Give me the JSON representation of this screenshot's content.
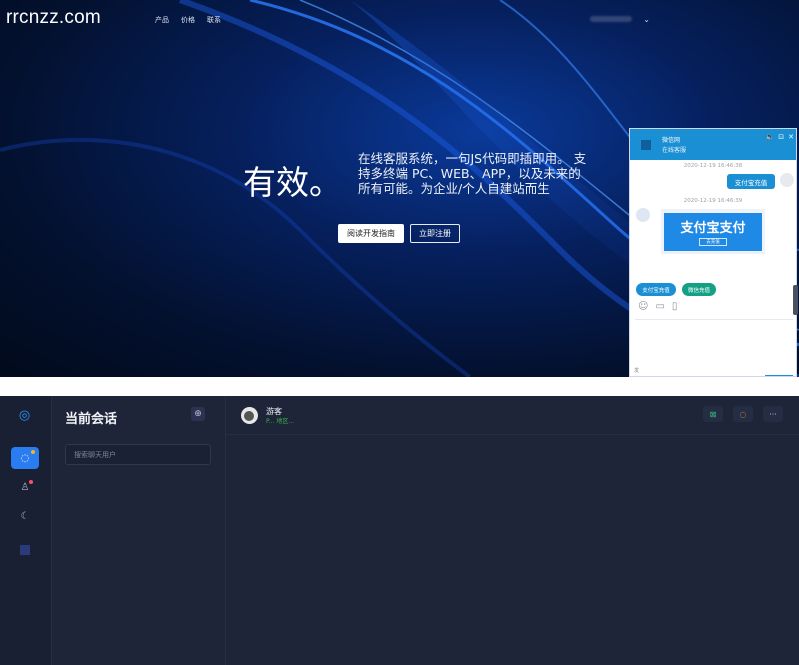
{
  "hero": {
    "watermark": "rrcnzz.com",
    "nav": [
      "产品",
      "价格",
      "联系"
    ],
    "headline": "有效。",
    "description": "在线客服系统，一句JS代码即插即用。 支持多终端 PC、WEB、APP，以及未来的所有可能。为企业/个人自建站而生",
    "btn_docs": "阅读开发指南",
    "btn_register": "立即注册",
    "account_chevron": "⌄"
  },
  "widget": {
    "name": "微信网",
    "status": "在线客服",
    "controls": [
      "🔈",
      "⊡",
      "✕"
    ],
    "time1": "2020-12-19 16:46:38",
    "time2": "2020-12-19 16:46:39",
    "user_msg": "支付宝充值",
    "card_title": "支付宝支付",
    "card_sub": "去充值",
    "chip_alipay": "支付宝充值",
    "chip_wechat": "微信充值",
    "tools": [
      "☺",
      "▭",
      "▯"
    ],
    "footer": "发"
  },
  "app": {
    "logo": "◎",
    "rail_icons": [
      "◌",
      "♙",
      "☾"
    ],
    "conv_title": "当前会话",
    "conv_add": "⊕",
    "search_placeholder": "搜索聊天用户",
    "visitor_name": "游客",
    "visitor_sub": "P... 地区...",
    "actions": [
      "⊠",
      "◌",
      "···"
    ]
  },
  "colors": {
    "hero_bg": "#03112f",
    "widget_accent": "#1a8fd4",
    "app_bg": "#1e2539",
    "rail_active": "#2a7df0"
  }
}
